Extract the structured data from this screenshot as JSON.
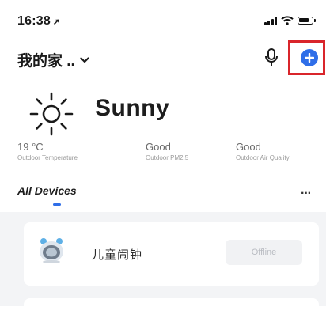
{
  "status_bar": {
    "time": "16:38",
    "location_glyph": "➚"
  },
  "header": {
    "home_title": "我的家 ..",
    "add_highlight_color": "#d9252b",
    "add_button_color": "#2f6ee8"
  },
  "weather": {
    "condition": "Sunny",
    "metrics": [
      {
        "value": "19 °C",
        "label": "Outdoor Temperature"
      },
      {
        "value": "Good",
        "label": "Outdoor PM2.5"
      },
      {
        "value": "Good",
        "label": "Outdoor Air Quality"
      }
    ]
  },
  "devices": {
    "tab_label": "All Devices",
    "more_glyph": "···",
    "items": [
      {
        "name": "儿童闹钟",
        "status": "Offline"
      }
    ]
  }
}
